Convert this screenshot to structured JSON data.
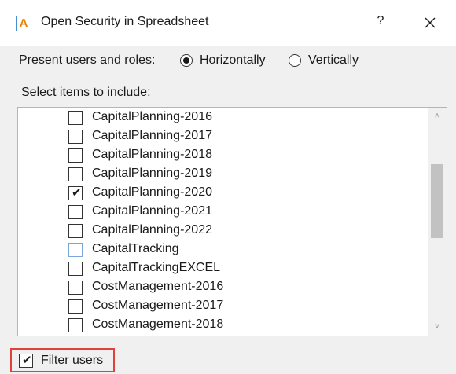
{
  "window": {
    "app_icon_letter": "A",
    "title": "Open Security in Spreadsheet",
    "help_label": "?",
    "close_glyph": "×"
  },
  "present": {
    "label": "Present users and roles:",
    "options": [
      {
        "label": "Horizontally",
        "selected": true
      },
      {
        "label": "Vertically",
        "selected": false
      }
    ]
  },
  "select_label": "Select items to include:",
  "items": [
    {
      "label": "CapitalPlanning-2016",
      "checked": false
    },
    {
      "label": "CapitalPlanning-2017",
      "checked": false
    },
    {
      "label": "CapitalPlanning-2018",
      "checked": false
    },
    {
      "label": "CapitalPlanning-2019",
      "checked": false
    },
    {
      "label": "CapitalPlanning-2020",
      "checked": true
    },
    {
      "label": "CapitalPlanning-2021",
      "checked": false
    },
    {
      "label": "CapitalPlanning-2022",
      "checked": false
    },
    {
      "label": "CapitalTracking",
      "checked": false,
      "focused": true
    },
    {
      "label": "CapitalTrackingEXCEL",
      "checked": false
    },
    {
      "label": "CostManagement-2016",
      "checked": false
    },
    {
      "label": "CostManagement-2017",
      "checked": false
    },
    {
      "label": "CostManagement-2018",
      "checked": false
    }
  ],
  "filter_users": {
    "label": "Filter users",
    "checked": true
  },
  "colors": {
    "highlight_border": "#e0413a",
    "app_icon_letter": "#e8850c",
    "app_icon_border": "#4a8fd6"
  }
}
